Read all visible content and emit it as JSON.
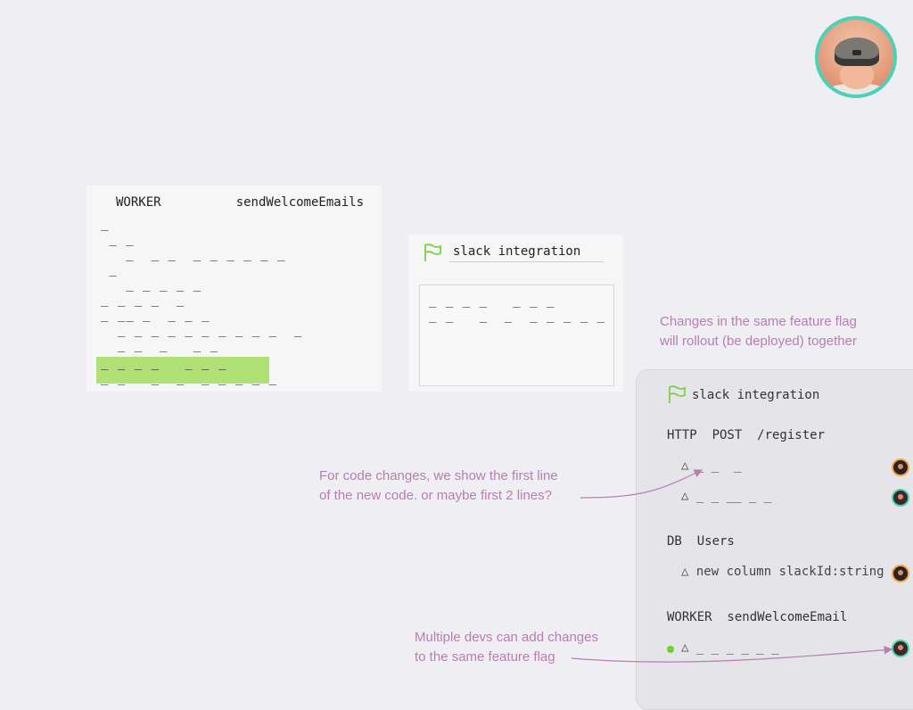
{
  "worker_card": {
    "label": "WORKER",
    "name": "sendWelcomeEmails",
    "lines": [
      "_",
      " _ _",
      "   _  _ _  _ _ _ _ _ _",
      " _",
      "   _ _ _ _ _",
      "_ _ _ _  _",
      "_ __ _  _ _ _",
      "  _ _ _ _ _ _ _ _ _ _  _",
      "  _ _  _   _ _"
    ],
    "highlighted_lines": [
      "_ _ _ _   _ _ _",
      "_ _   _  _  _ _ _ _ _"
    ]
  },
  "flag_card": {
    "title": "slack integration",
    "lines": [
      "_ _ _ _   _ _ _",
      "_ _   _  _  _ _ _ _ _"
    ]
  },
  "notes": {
    "rollout_line1": "Changes in the same feature flag",
    "rollout_line2": "will rollout (be deployed) together",
    "code_line1": "For code changes, we show the first line",
    "code_line2": "of the new code. or maybe first 2 lines?",
    "devs_line1": "Multiple devs can add changes",
    "devs_line2": "to the same feature flag"
  },
  "panel": {
    "title": "slack integration",
    "http_section": "HTTP  POST  /register",
    "http_item1": "△ _ _  _",
    "http_item2": "△ _ _ __ _ _",
    "db_section": "DB  Users",
    "db_item1": "△ new column slackId:string",
    "worker_section": "WORKER  sendWelcomeEmail",
    "worker_item1": "△ _ _ _ _ _ _"
  },
  "colors": {
    "background": "#efeef3",
    "highlight": "#b1e176",
    "annotation": "#b67fb0",
    "flag_green": "#7fcf4a",
    "avatar_ring": "#4bd1b5",
    "dev_orange": "#f3a63c"
  }
}
